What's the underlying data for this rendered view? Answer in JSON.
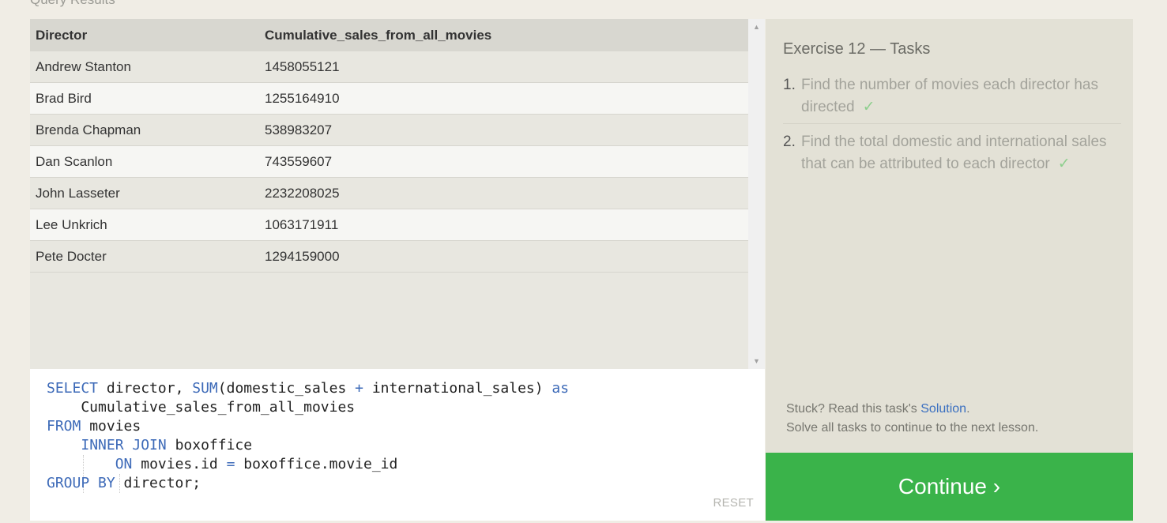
{
  "results": {
    "section_title": "Query Results",
    "columns": [
      "Director",
      "Cumulative_sales_from_all_movies"
    ],
    "rows": [
      [
        "Andrew Stanton",
        "1458055121"
      ],
      [
        "Brad Bird",
        "1255164910"
      ],
      [
        "Brenda Chapman",
        "538983207"
      ],
      [
        "Dan Scanlon",
        "743559607"
      ],
      [
        "John Lasseter",
        "2232208025"
      ],
      [
        "Lee Unkrich",
        "1063171911"
      ],
      [
        "Pete Docter",
        "1294159000"
      ]
    ]
  },
  "scroll": {
    "up_icon": "▲",
    "down_icon": "▼"
  },
  "editor": {
    "l1": {
      "k1": "SELECT",
      "t1": " director, ",
      "k2": "SUM",
      "t2": "(domestic_sales ",
      "k3": "+",
      "t3": " international_sales) ",
      "k4": "as"
    },
    "l2": {
      "t1": "    Cumulative_sales_from_all_movies"
    },
    "l3": {
      "k1": "FROM",
      "t1": " movies"
    },
    "l4": {
      "p": "    ",
      "k1": "INNER JOIN",
      "t1": " boxoffice"
    },
    "l5": {
      "p": "        ",
      "k1": "ON",
      "t1": " movies.id ",
      "k2": "=",
      "t2": " boxoffice.movie_id"
    },
    "l6": {
      "k1": "GROUP BY",
      "t1": " director;"
    },
    "reset_label": "RESET"
  },
  "exercise": {
    "title": "Exercise 12 — Tasks",
    "tasks": [
      {
        "num": "1.",
        "text": "Find the number of movies each director has directed",
        "check": "✓"
      },
      {
        "num": "2.",
        "text": "Find the total domestic and international sales that can be attributed to each director",
        "check": "✓"
      }
    ],
    "help_prefix": "Stuck? Read this task's ",
    "help_link": "Solution",
    "help_suffix": ".",
    "help_line2": "Solve all tasks to continue to the next lesson."
  },
  "continue_label": "Continue ›",
  "colors": {
    "accent": "#3ab34a",
    "keyword": "#3d6ab8",
    "link": "#3a6fc0"
  }
}
